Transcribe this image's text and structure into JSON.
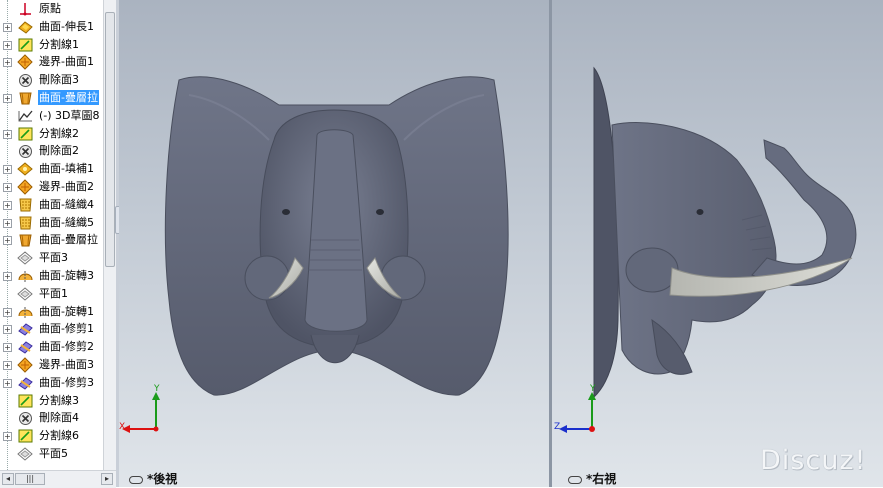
{
  "feature_tree": {
    "items": [
      {
        "label": "原點",
        "icon": "origin-icon",
        "expandable": false,
        "selected": false
      },
      {
        "label": "曲面-伸長1",
        "icon": "surface-extrude-icon",
        "expandable": true,
        "selected": false
      },
      {
        "label": "分割線1",
        "icon": "split-line-icon",
        "expandable": true,
        "selected": false
      },
      {
        "label": "邊界-曲面1",
        "icon": "boundary-surface-icon",
        "expandable": true,
        "selected": false
      },
      {
        "label": "刪除面3",
        "icon": "delete-face-icon",
        "expandable": false,
        "selected": false
      },
      {
        "label": "曲面-疊層拉",
        "icon": "surface-loft-icon",
        "expandable": true,
        "selected": true
      },
      {
        "label": "(-) 3D草圖8",
        "icon": "3d-sketch-icon",
        "expandable": false,
        "selected": false
      },
      {
        "label": "分割線2",
        "icon": "split-line-icon",
        "expandable": true,
        "selected": false
      },
      {
        "label": "刪除面2",
        "icon": "delete-face-icon",
        "expandable": false,
        "selected": false
      },
      {
        "label": "曲面-填補1",
        "icon": "surface-fill-icon",
        "expandable": true,
        "selected": false
      },
      {
        "label": "邊界-曲面2",
        "icon": "boundary-surface-icon",
        "expandable": true,
        "selected": false
      },
      {
        "label": "曲面-縫織4",
        "icon": "surface-knit-icon",
        "expandable": true,
        "selected": false
      },
      {
        "label": "曲面-縫織5",
        "icon": "surface-knit-icon",
        "expandable": true,
        "selected": false
      },
      {
        "label": "曲面-疊層拉",
        "icon": "surface-loft-icon",
        "expandable": true,
        "selected": false
      },
      {
        "label": "平面3",
        "icon": "plane-icon",
        "expandable": false,
        "selected": false
      },
      {
        "label": "曲面-旋轉3",
        "icon": "surface-revolve-icon",
        "expandable": true,
        "selected": false
      },
      {
        "label": "平面1",
        "icon": "plane-icon",
        "expandable": false,
        "selected": false
      },
      {
        "label": "曲面-旋轉1",
        "icon": "surface-revolve-icon",
        "expandable": true,
        "selected": false
      },
      {
        "label": "曲面-修剪1",
        "icon": "surface-trim-icon",
        "expandable": true,
        "selected": false
      },
      {
        "label": "曲面-修剪2",
        "icon": "surface-trim-icon",
        "expandable": true,
        "selected": false
      },
      {
        "label": "邊界-曲面3",
        "icon": "boundary-surface-icon",
        "expandable": true,
        "selected": false
      },
      {
        "label": "曲面-修剪3",
        "icon": "surface-trim-icon",
        "expandable": true,
        "selected": false
      },
      {
        "label": "分割線3",
        "icon": "split-line-icon",
        "expandable": false,
        "selected": false
      },
      {
        "label": "刪除面4",
        "icon": "delete-face-icon",
        "expandable": false,
        "selected": false
      },
      {
        "label": "分割線6",
        "icon": "split-line-icon",
        "expandable": true,
        "selected": false
      },
      {
        "label": "平面5",
        "icon": "plane-icon",
        "expandable": false,
        "selected": false
      }
    ]
  },
  "viewports": {
    "left": {
      "label": "*後視",
      "axes": [
        "X",
        "Y"
      ]
    },
    "right": {
      "label": "*右視",
      "axes": [
        "Z",
        "Y"
      ]
    }
  },
  "watermark": "Discuz!",
  "colors": {
    "model": "#5f6577",
    "tusk": "#c8c9c4",
    "selection": "#3399ff",
    "axis_x": "#d11",
    "axis_y": "#1a9b1a",
    "axis_z": "#1a2fcc"
  }
}
